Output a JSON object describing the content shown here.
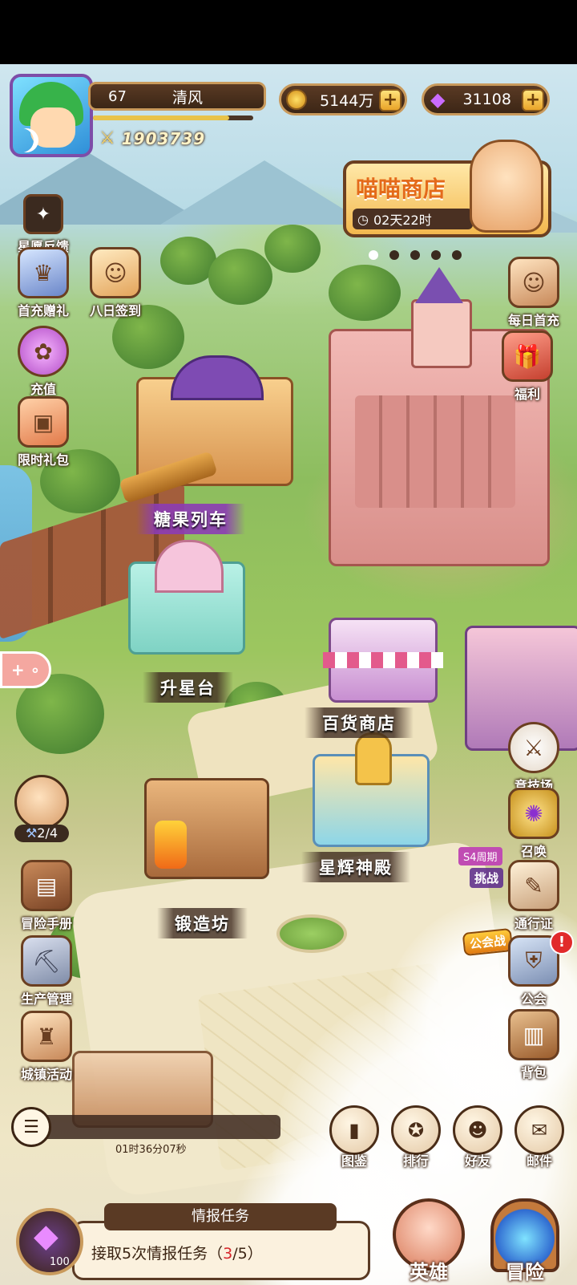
{
  "player": {
    "level": "67",
    "name": "清风",
    "power": "1903739"
  },
  "currency": {
    "gold": "5144万",
    "gems": "31108"
  },
  "shop_banner": {
    "title": "喵喵商店",
    "timer": "02天22时"
  },
  "left_menu": [
    {
      "label": "星愿反馈",
      "icon": "star-card-icon"
    },
    {
      "label": "首充赠礼",
      "icon": "first-recharge-icon"
    },
    {
      "label": "八日签到",
      "icon": "sign-in-icon"
    },
    {
      "label": "充值",
      "icon": "recharge-gems-icon"
    },
    {
      "label": "限时礼包",
      "icon": "gift-box-icon"
    }
  ],
  "right_menu": [
    {
      "label": "每日首充",
      "icon": "daily-recharge-icon"
    },
    {
      "label": "福利",
      "icon": "welfare-gift-icon"
    }
  ],
  "buildings": {
    "candy_train": "糖果列车",
    "star_platform": "升星台",
    "department_store": "百货商店",
    "star_temple": "星辉神殿",
    "forge": "锻造坊"
  },
  "left_lower_menu": {
    "progress_text": "2/4",
    "items": [
      {
        "label": "冒险手册",
        "icon": "book-icon"
      },
      {
        "label": "生产管理",
        "icon": "shovel-icon"
      },
      {
        "label": "城镇活动",
        "icon": "town-tower-icon"
      }
    ]
  },
  "right_lower_menu": [
    {
      "label": "竞技场",
      "icon": "crossed-swords-icon"
    },
    {
      "label": "召唤",
      "icon": "summon-icon"
    },
    {
      "label": "通行证",
      "icon": "pass-scroll-icon"
    },
    {
      "label": "公会",
      "icon": "guild-shield-icon"
    },
    {
      "label": "背包",
      "icon": "backpack-icon"
    }
  ],
  "season_tag": "S4周期",
  "challenge_tag": "挑战",
  "guild_war_badge": "公会战",
  "alert_badge": "!",
  "bottom_icons": [
    {
      "label": "图鉴",
      "icon": "codex-icon"
    },
    {
      "label": "排行",
      "icon": "ranking-medal-icon"
    },
    {
      "label": "好友",
      "icon": "friends-icon"
    },
    {
      "label": "邮件",
      "icon": "mail-icon"
    }
  ],
  "chat_timer": "01时36分07秒",
  "quest": {
    "header": "情报任务",
    "text_prefix": "接取5次情报任务（",
    "current": "3",
    "text_suffix": "/5）",
    "reward_count": "100"
  },
  "main_buttons": {
    "heroes": "英雄",
    "adventure": "冒险"
  },
  "colors": {
    "accent_gold": "#e9a429",
    "dark_brown": "#3c2616",
    "quest_red": "#d6262b",
    "purple_label": "#8c3cb4"
  }
}
